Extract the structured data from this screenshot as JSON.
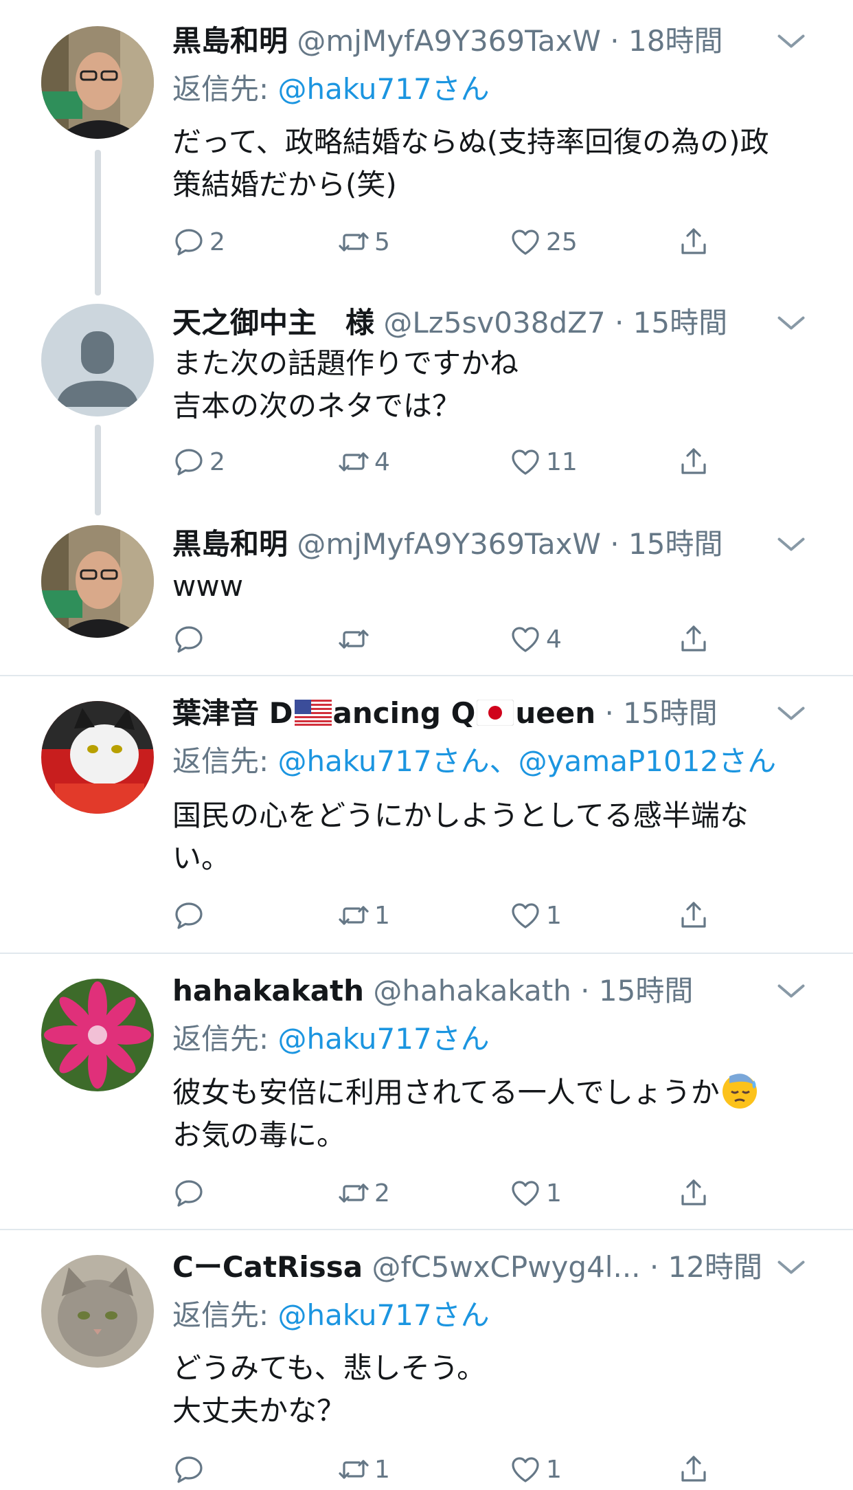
{
  "tweets": [
    {
      "name": "黒島和明",
      "handle": "@mjMyfA9Y369TaxW",
      "time": "18時間",
      "reply_prefix": "返信先: ",
      "reply_links": "@haku717さん",
      "text": "だって、政略結婚ならぬ(支持率回復の為の)政\n策結婚だから(笑)",
      "reply_count": "2",
      "retweet_count": "5",
      "like_count": "25"
    },
    {
      "name": "天之御中主　様",
      "handle": "@Lz5sv038dZ7",
      "time": "15時間",
      "text": "また次の話題作りですかね\n吉本の次のネタでは？",
      "reply_count": "2",
      "retweet_count": "4",
      "like_count": "11"
    },
    {
      "name": "黒島和明",
      "handle": "@mjMyfA9Y369TaxW",
      "time": "15時間",
      "text": "www",
      "reply_count": "",
      "retweet_count": "",
      "like_count": "4"
    },
    {
      "name_part1": "葉津音 D",
      "name_part2": "ancing Q",
      "name_part3": "ueen",
      "handle": "",
      "time": "15時間",
      "reply_prefix": "返信先: ",
      "reply_links": "@haku717さん、@yamaP1012さん",
      "text": "国民の心をどうにかしようとしてる感半端な\nい。",
      "reply_count": "",
      "retweet_count": "1",
      "like_count": "1"
    },
    {
      "name": "hahakakath",
      "handle": "@hahakakath",
      "time": "15時間",
      "reply_prefix": "返信先: ",
      "reply_links": "@haku717さん",
      "text_line1": "彼女も安倍に利用されてる一人でしょうか",
      "text_line2": "お気の毒に。",
      "reply_count": "",
      "retweet_count": "2",
      "like_count": "1"
    },
    {
      "name": "CーCatRissa",
      "handle": "@fC5wxCPwyg4l...",
      "time": "12時間",
      "reply_prefix": "返信先: ",
      "reply_links": "@haku717さん",
      "text": "どうみても、悲しそう。\n大丈夫かな？",
      "reply_count": "",
      "retweet_count": "1",
      "like_count": "1"
    }
  ],
  "separator": " · ",
  "icons": {
    "reply": "reply-icon",
    "retweet": "retweet-icon",
    "like": "heart-icon",
    "share": "share-icon",
    "more": "chevron-down-icon"
  },
  "colors": {
    "link": "#1b95e0",
    "secondary": "#657786",
    "thread_line": "#d5dbe0"
  }
}
